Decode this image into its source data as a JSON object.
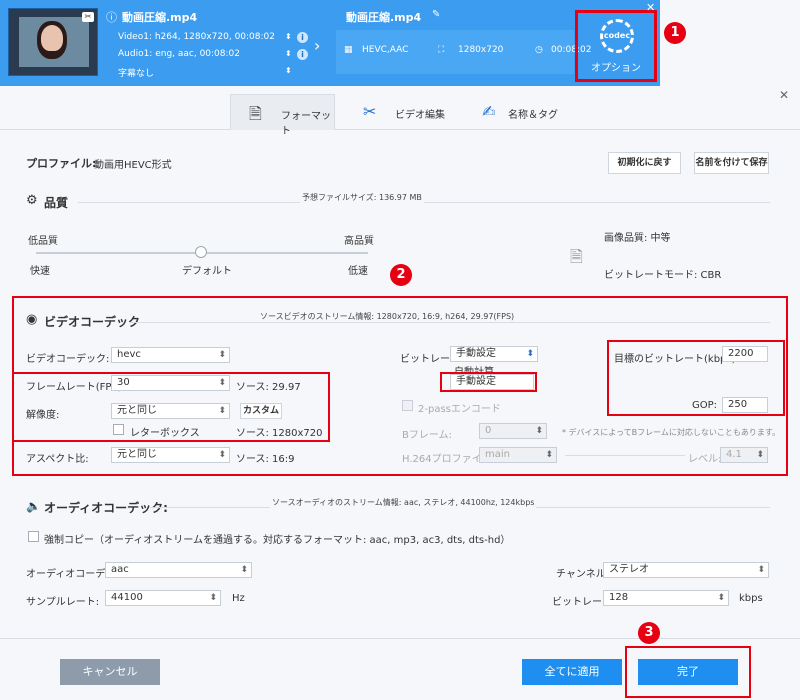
{
  "header": {
    "left_title": "動画圧縮.mp4",
    "video_line": "Video1: h264, 1280x720, 00:08:02",
    "audio_line": "Audio1: eng, aac, 00:08:02",
    "subtitle_line": "字幕なし",
    "right_title": "動画圧縮.mp4",
    "format": "HEVC,AAC",
    "resolution": "1280x720",
    "duration": "00:08:02",
    "option_gear_text": "codec",
    "option_label": "オプション"
  },
  "badges": [
    "1",
    "2",
    "3"
  ],
  "tabs": [
    {
      "label": "フォーマット"
    },
    {
      "label": "ビデオ編集"
    },
    {
      "label": "名称＆タグ"
    }
  ],
  "profile": {
    "label": "プロファイル:",
    "value": "動画用HEVC形式",
    "reset_button": "初期化に戻す",
    "save_button": "名前を付けて保存"
  },
  "quality": {
    "title": "品質",
    "expected_size": "予想ファイルサイズ: 136.97 MB",
    "low": "低品質",
    "high": "高品質",
    "fast": "快速",
    "default": "デフォルト",
    "slow": "低速",
    "image_quality": "画像品質: 中等",
    "bitrate_mode": "ビットレートモード: CBR"
  },
  "video": {
    "title": "ビデオコーデック",
    "stream_info": "ソースビデオのストリーム情報: 1280x720, 16:9, h264, 29.97(FPS)",
    "codec_label": "ビデオコーデック:",
    "codec_value": "hevc",
    "fps_label": "フレームレート(FPS):",
    "fps_value": "30",
    "fps_source": "ソース: 29.97",
    "res_label": "解像度:",
    "res_value": "元と同じ",
    "custom_button": "カスタム",
    "letterbox": "レターボックス",
    "res_source": "ソース: 1280x720",
    "aspect_label": "アスペクト比:",
    "aspect_value": "元と同じ",
    "aspect_source": "ソース: 16:9",
    "bitrate_label": "ビットレート:",
    "bitrate_value": "手動設定",
    "bitrate_opt1": "自動計算",
    "bitrate_opt2": "手動設定",
    "twopass": "2-passエンコード",
    "bframe_label": "Bフレーム:",
    "bframe_value": "0",
    "bframe_note": "* デバイスによってBフレームに対応しないこともあります。",
    "h264_label": "H.264プロファイル:",
    "h264_value": "main",
    "level_label": "レベル:",
    "level_value": "4.1",
    "target_bitrate_label": "目標のビットレート(kbps):",
    "target_bitrate_value": "2200",
    "gop_label": "GOP:",
    "gop_value": "250"
  },
  "audio": {
    "title": "オーディオコーデック:",
    "stream_info": "ソースオーディオのストリーム情報: aac, ステレオ, 44100hz, 124kbps",
    "force_copy": "強制コピー（オーディオストリームを通過する。対応するフォーマット: aac, mp3, ac3, dts, dts-hd）",
    "codec_label": "オーディオコーデック:",
    "codec_value": "aac",
    "channel_label": "チャンネル:",
    "channel_value": "ステレオ",
    "sample_label": "サンプルレート:",
    "sample_value": "44100",
    "sample_unit": "Hz",
    "bitrate_label": "ビットレート:",
    "bitrate_value": "128",
    "bitrate_unit": "kbps"
  },
  "footer": {
    "cancel": "キャンセル",
    "apply_all": "全てに適用",
    "done": "完了"
  },
  "colors": {
    "header_blue": "#3b9cf0",
    "accent_red": "#e60012",
    "button_blue": "#1e8ef0"
  }
}
